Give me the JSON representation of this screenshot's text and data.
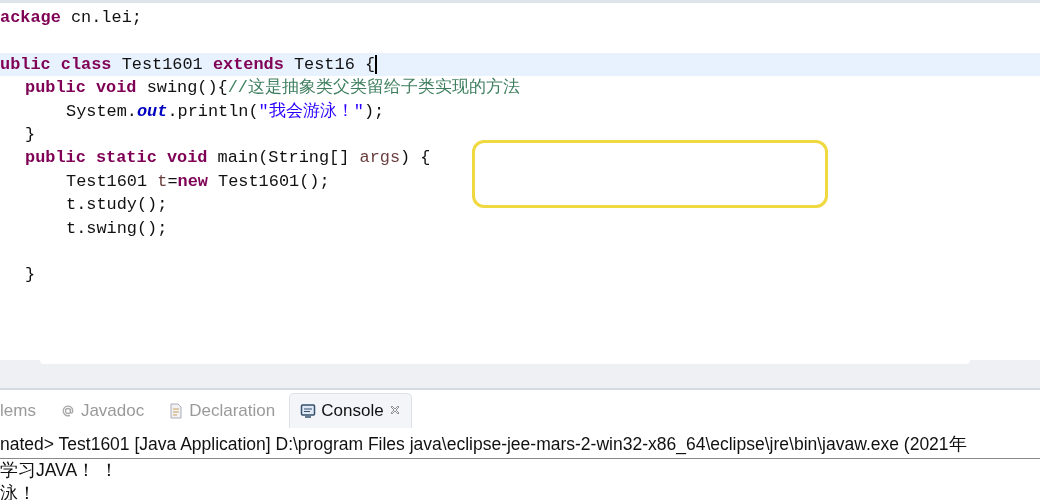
{
  "editor": {
    "lines": [
      {
        "kind": "top",
        "current": false,
        "tokens": [
          {
            "kind": "keyword",
            "text": "ackage"
          },
          {
            "kind": "plain",
            "text": " cn.lei;"
          }
        ]
      },
      {
        "kind": "top",
        "current": false
      },
      {
        "kind": "top",
        "current": true,
        "tokens": [
          {
            "kind": "keyword",
            "text": "ublic class"
          },
          {
            "kind": "plain",
            "text": " Test1601 "
          },
          {
            "kind": "keyword",
            "text": "extends"
          },
          {
            "kind": "plain",
            "text": " Test16 {"
          }
        ]
      },
      {
        "kind": "member",
        "current": false,
        "tokens": [
          {
            "kind": "keyword",
            "text": "public void"
          },
          {
            "kind": "plain",
            "text": " swing(){"
          },
          {
            "kind": "comment",
            "text": "//这是抽象类父类留给子类实现的方法"
          }
        ]
      },
      {
        "kind": "body",
        "current": false,
        "tokens": [
          {
            "kind": "plain",
            "text": "System."
          },
          {
            "kind": "field",
            "text": "out"
          },
          {
            "kind": "plain",
            "text": ".println("
          },
          {
            "kind": "string",
            "text": "\"我会游泳！\""
          },
          {
            "kind": "plain",
            "text": ");"
          }
        ]
      },
      {
        "kind": "member",
        "current": false,
        "tokens": [
          {
            "kind": "plain",
            "text": "}"
          }
        ]
      },
      {
        "kind": "member",
        "current": false,
        "tokens": [
          {
            "kind": "keyword",
            "text": "public static void"
          },
          {
            "kind": "plain",
            "text": " main(String[] "
          },
          {
            "kind": "variable",
            "text": "args"
          },
          {
            "kind": "plain",
            "text": ") {"
          }
        ]
      },
      {
        "kind": "body",
        "current": false,
        "tokens": [
          {
            "kind": "plain",
            "text": "Test1601 "
          },
          {
            "kind": "variable",
            "text": "t"
          },
          {
            "kind": "plain",
            "text": "="
          },
          {
            "kind": "keyword",
            "text": "new"
          },
          {
            "kind": "plain",
            "text": " Test1601();"
          }
        ]
      },
      {
        "kind": "body",
        "current": false,
        "tokens": [
          {
            "kind": "plain",
            "text": "t.study();"
          }
        ]
      },
      {
        "kind": "body",
        "current": false,
        "tokens": [
          {
            "kind": "plain",
            "text": "t.swing();"
          }
        ]
      },
      {
        "kind": "top",
        "current": false
      },
      {
        "kind": "member",
        "current": false,
        "tokens": [
          {
            "kind": "plain",
            "text": "}"
          }
        ]
      }
    ]
  },
  "tabs": [
    {
      "label": "lems",
      "selected": false
    },
    {
      "label": "Javadoc",
      "selected": false
    },
    {
      "label": "Declaration",
      "selected": false
    },
    {
      "label": "Console",
      "selected": true
    }
  ],
  "console": {
    "header": "nated> Test1601 [Java Application] D:\\program Files java\\eclipse-jee-mars-2-win32-x86_64\\eclipse\\jre\\bin\\javaw.exe (2021年",
    "output": [
      "学习JAVA！ ！",
      "泳！"
    ]
  }
}
